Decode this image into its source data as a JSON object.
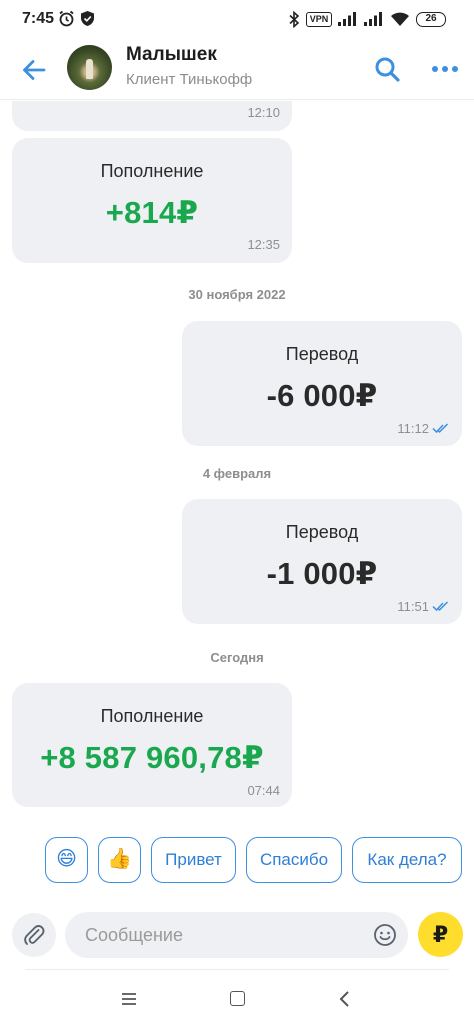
{
  "status_bar": {
    "time": "7:45",
    "vpn_label": "VPN",
    "battery_level": "26"
  },
  "header": {
    "name": "Малышек",
    "subtitle": "Клиент Тинькофф",
    "back_icon": "arrow-left-icon",
    "search_icon": "search-icon",
    "more_icon": "more-horizontal-icon",
    "accent_color": "#3d8fe0"
  },
  "messages": [
    {
      "direction": "in",
      "time": "12:10",
      "partial": true
    },
    {
      "direction": "in",
      "title": "Пополнение",
      "amount": "+814₽",
      "time": "12:35"
    },
    {
      "type": "date",
      "label": "30 ноября 2022"
    },
    {
      "direction": "out",
      "title": "Перевод",
      "amount": "-6 000₽",
      "time": "11:12",
      "read": true
    },
    {
      "type": "date",
      "label": "4 февраля"
    },
    {
      "direction": "out",
      "title": "Перевод",
      "amount": "-1 000₽",
      "time": "11:51",
      "read": true
    },
    {
      "type": "date",
      "label": "Сегодня"
    },
    {
      "direction": "in",
      "title": "Пополнение",
      "amount": "+8 587 960,78₽",
      "time": "07:44"
    }
  ],
  "quick_replies": [
    {
      "kind": "emoji",
      "label": "😄"
    },
    {
      "kind": "emoji",
      "label": "👍"
    },
    {
      "kind": "text",
      "label": "Привет"
    },
    {
      "kind": "text",
      "label": "Спасибо"
    },
    {
      "kind": "text",
      "label": "Как дела?"
    }
  ],
  "input": {
    "placeholder": "Сообщение",
    "ruble_button": "₽",
    "ruble_button_color": "#ffdd2d"
  },
  "colors": {
    "plus_amount": "#1aa84f",
    "bubble_bg": "#eef0f3"
  }
}
